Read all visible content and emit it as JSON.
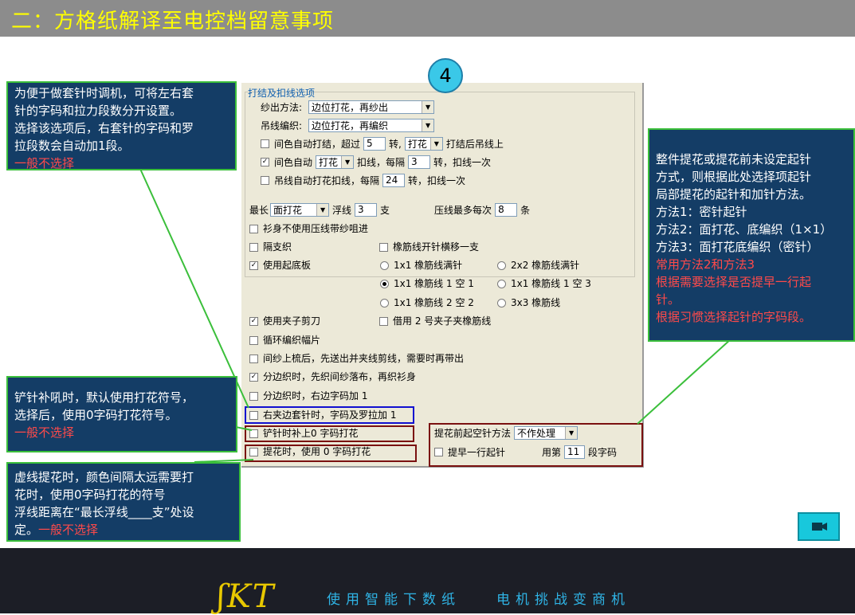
{
  "page_title": "二：方格纸解译至电控档留意事项",
  "badge": "4",
  "dialog": {
    "section_title": "打结及扣线选项",
    "yarn_out_label": "纱出方法:",
    "yarn_out_value": "边位打花，再纱出",
    "hang_label": "吊线编织:",
    "hang_value": "边位打花，再编织",
    "auto_knot": {
      "checked": false,
      "label1": "间色自动打结，超过",
      "value": "5",
      "label2": "转,",
      "combo": "打花",
      "label3": "打结后吊线上"
    },
    "auto_buckle": {
      "checked": true,
      "label1": "间色自动",
      "combo": "打花",
      "label2": "扣线，每隔",
      "value": "3",
      "label3": "转，扣线一次"
    },
    "hang_auto": {
      "checked": false,
      "label1": "吊线自动打花扣线，每隔",
      "value": "24",
      "label2": "转，扣线一次"
    },
    "longest_label": "最长",
    "longest_combo": "面打花",
    "float_label": "浮线",
    "float_value": "3",
    "float_unit": "支",
    "press_label": "压线最多每次",
    "press_value": "8",
    "press_unit": "条",
    "options": [
      {
        "checked": false,
        "label": "衫身不使用压线带纱咀进"
      },
      {
        "checked": false,
        "label": "隔支织"
      },
      {
        "checked": true,
        "label": "使用起底板"
      },
      {
        "checked": true,
        "label": "使用夹子剪刀"
      },
      {
        "checked": false,
        "label": "循环编织幅片"
      },
      {
        "checked": false,
        "label": "间纱上梳后，先送出并夹线剪线，需要时再带出"
      },
      {
        "checked": true,
        "label": "分边织时，先织间纱落布，再织衫身"
      },
      {
        "checked": false,
        "label": "分边织时，右边字码加 1"
      },
      {
        "checked": false,
        "label": "右夹边套针时，字码及罗拉加 1"
      },
      {
        "checked": false,
        "label": "铲针时补上0 字码打花"
      },
      {
        "checked": false,
        "label": "提花时，使用 0 字码打花"
      }
    ],
    "elastic_shift": {
      "checked": false,
      "label": "橡筋线开针横移一支"
    },
    "elastic_radios": [
      {
        "selected": false,
        "label": "1x1 橡筋线满针"
      },
      {
        "selected": false,
        "label": "2x2 橡筋线满针"
      },
      {
        "selected": true,
        "label": "1x1 橡筋线 1 空 1"
      },
      {
        "selected": false,
        "label": "1x1 橡筋线 1 空 3"
      },
      {
        "selected": false,
        "label": "1x1 橡筋线 2 空 2"
      },
      {
        "selected": false,
        "label": "3x3 橡筋线"
      }
    ],
    "borrow_clip": {
      "checked": false,
      "label": "借用 2 号夹子夹橡筋线"
    },
    "jacquard_start_label": "提花前起空针方法",
    "jacquard_start_value": "不作处理",
    "early_row": {
      "checked": false,
      "label": "提早一行起针"
    },
    "use_label": "用第",
    "use_value": "11",
    "segment_label": "段字码"
  },
  "callouts": {
    "top_left": {
      "lines": [
        "为便于做套针时调机，可将左右套",
        "针的字码和拉力段数分开设置。",
        "选择该选项后，右套针的字码和罗",
        "拉段数会自动加1段。"
      ],
      "red": "一般不选择"
    },
    "mid_left": {
      "lines": [
        "铲针补吼时，默认使用打花符号，",
        "选择后，使用0字码打花符号。"
      ],
      "red": "一般不选择"
    },
    "bottom_left": {
      "lines": [
        "虚线提花时，颜色间隔太远需要打",
        "花时，使用0字码打花的符号",
        "浮线距离在“最长浮线____支”处设"
      ],
      "last_white": "定。",
      "red": "一般不选择"
    },
    "right": {
      "lines": [
        "整件提花或提花前未设定起针",
        "方式，则根据此处选择项起针",
        "局部提花的起针和加针方法。",
        "方法1：密针起针",
        "方法2：面打花、底编织（1×1）",
        "方法3：面打花底编织（密针）"
      ],
      "red_lines": [
        "常用方法2和方法3",
        "根据需要选择是否提早一行起",
        "针。",
        "根据习惯选择起针的字码段。"
      ]
    }
  },
  "footer": {
    "logo": "ʃKT",
    "slogan_left": "使用智能下数纸",
    "slogan_right": "电机挑战变商机"
  },
  "colors": {
    "title_text": "#ffff00",
    "callout_bg": "#143d66",
    "callout_border": "#3bbf3b",
    "note_red": "#ff4a4a",
    "slogan": "#2fb4e6",
    "logo": "#e8c800"
  }
}
